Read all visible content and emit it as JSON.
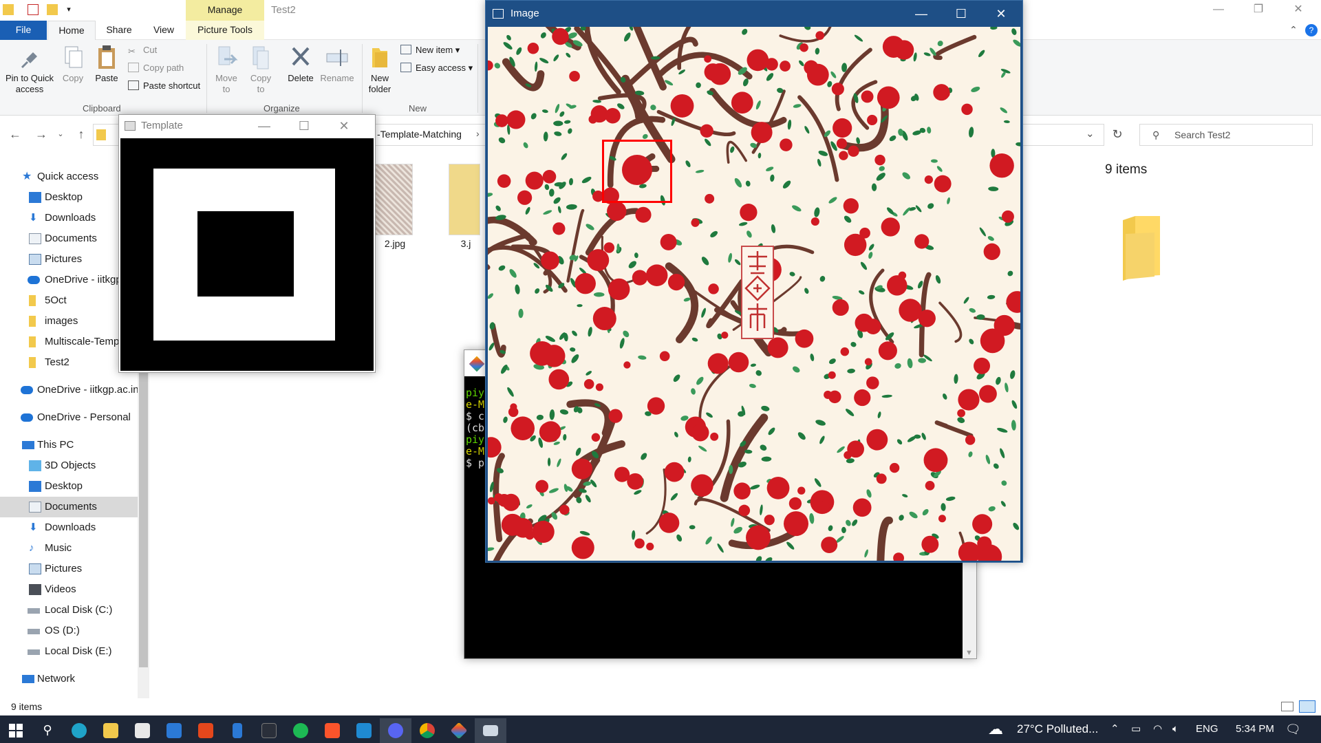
{
  "explorer": {
    "manage_tab": "Manage",
    "window_title": "Test2",
    "tabs": {
      "file": "File",
      "home": "Home",
      "share": "Share",
      "view": "View",
      "picture_tools": "Picture Tools"
    },
    "ribbon": {
      "pin": "Pin to Quick access",
      "copy": "Copy",
      "paste": "Paste",
      "cut": "Cut",
      "copy_path": "Copy path",
      "paste_shortcut": "Paste shortcut",
      "clipboard": "Clipboard",
      "move_to": "Move to",
      "copy_to": "Copy to",
      "delete": "Delete",
      "rename": "Rename",
      "organize": "Organize",
      "new_folder": "New folder",
      "new_item": "New item",
      "easy_access": "Easy access",
      "new": "New"
    },
    "address_breadcrumb": "-Template-Matching",
    "search_placeholder": "Search Test2",
    "nav": {
      "quick_access": "Quick access",
      "desktop": "Desktop",
      "downloads": "Downloads",
      "documents": "Documents",
      "pictures": "Pictures",
      "onedrive_iitkgp_short": "OneDrive - iitkgp",
      "fiveoct": "5Oct",
      "images": "images",
      "multiscale": "Multiscale-Temp",
      "test2": "Test2",
      "onedrive_iitkgp": "OneDrive - iitkgp.ac.in",
      "onedrive_personal": "OneDrive - Personal",
      "this_pc": "This PC",
      "objects3d": "3D Objects",
      "desktop2": "Desktop",
      "documents2": "Documents",
      "downloads2": "Downloads",
      "music": "Music",
      "pictures2": "Pictures",
      "videos": "Videos",
      "local_c": "Local Disk (C:)",
      "os_d": "OS (D:)",
      "local_e": "Local Disk (E:)",
      "network": "Network"
    },
    "files": {
      "file2": "2.jpg",
      "file3": "3.j"
    },
    "items_count_right": "9 items",
    "status_items": "9 items"
  },
  "template_window": {
    "title": "Template"
  },
  "image_window": {
    "title": "Image"
  },
  "terminal": {
    "lines": [
      "piy",
      "e-M",
      "$ c",
      "(cb",
      "piy",
      "e-M",
      "$ p"
    ]
  },
  "taskbar": {
    "weather": "27°C Polluted...",
    "language": "ENG",
    "time": "5:34 PM"
  },
  "colors": {
    "file_tab": "#1a5fb4",
    "manage_tab": "#f3eca0",
    "image_titlebar": "#1e4f86",
    "taskbar": "#1d2637",
    "match_box": "#ff0000",
    "apple_red": "#d11a22",
    "leaf_green": "#1f7a3e",
    "branch_brown": "#6b3a2e"
  }
}
